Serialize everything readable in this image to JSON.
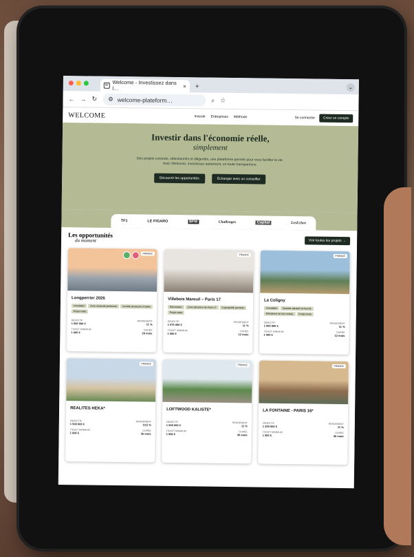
{
  "browser": {
    "tab_title": "Welcome - Investissez dans l…",
    "tab_close": "×",
    "new_tab": "+",
    "url": "welcome-plateform…",
    "favicon_text": "W"
  },
  "site": {
    "logo": "WELCOME",
    "nav": [
      "Investir",
      "Entreprises",
      "Méthode"
    ],
    "login": "Se connecter",
    "cta": "Créer un compte"
  },
  "hero": {
    "title": "Investir dans l'économie réelle,",
    "subtitle": "simplement",
    "description": "Des projets concrets, sélectionnés et diligentés, une plateforme pensée pour vous faciliter la vie. Avec Welcome, investissez autrement, en toute transparence.",
    "btn_primary": "Découvrir les opportunités",
    "btn_secondary": "Échanger avec un conseiller"
  },
  "press": [
    "TF1",
    "LE FIGARO",
    "BFM",
    "Challenges",
    "Capital",
    "LesEchos"
  ],
  "opportunities": {
    "title": "Les opportunités",
    "subtitle": "du moment",
    "see_all": "Voir toutes les projets →",
    "cards": [
      {
        "title": "Longperrier 2026",
        "badge": "FRANCE",
        "tags": [
          "Immobilier",
          "Zone d'activité pertinente",
          "Société structurée à faible",
          "Projet mixte"
        ],
        "s1_label": "OBJECTIF",
        "s1": "1 500 000 €",
        "s2_label": "RENDEMENT",
        "s2": "11 %",
        "s3_label": "TICKET MINIMUM",
        "s3": "1 000 €",
        "s4_label": "DURÉE",
        "s4": "24 mois",
        "img_colors": [
          "#f3c49a",
          "#9aa3ad",
          "#6f7b86"
        ]
      },
      {
        "title": "Villebois Mareuil – Paris 17",
        "badge": "FRANCE",
        "tags": [
          "Rénovation",
          "Zone attractive de Paris 17",
          "Copropriété premium",
          "Projet mixte"
        ],
        "s1_label": "OBJECTIF",
        "s1": "1 075 000 €",
        "s2_label": "RENDEMENT",
        "s2": "11 %",
        "s3_label": "TICKET MINIMUM",
        "s3": "1 000 €",
        "s4_label": "DURÉE",
        "s4": "12 mois",
        "img_colors": [
          "#e8e4df",
          "#bfb7ad",
          "#8a7f74"
        ]
      },
      {
        "title": "La Coligny",
        "badge": "FRANCE",
        "tags": [
          "Immobilier",
          "Quartier attractif recherché",
          "Résidence de bon niveau",
          "Projet mixte"
        ],
        "s1_label": "OBJECTIF",
        "s1": "1 000 000 €",
        "s2_label": "RENDEMENT",
        "s2": "11 %",
        "s3_label": "TICKET MINIMUM",
        "s3": "1 000 €",
        "s4_label": "DURÉE",
        "s4": "12 mois",
        "img_colors": [
          "#9cc0dc",
          "#5f7f57",
          "#b69a6f"
        ]
      },
      {
        "title": "REALITES HEKA*",
        "badge": "FRANCE",
        "tags": [],
        "s1_label": "OBJECTIF",
        "s1": "1 500 000 €",
        "s2_label": "RENDEMENT",
        "s2": "10,5 %",
        "s3_label": "TICKET MINIMUM",
        "s3": "1 000 €",
        "s4_label": "DURÉE",
        "s4": "36 mois",
        "img_colors": [
          "#c9d8e6",
          "#d6c4a3",
          "#6b8a55"
        ]
      },
      {
        "title": "LOFTWOOD KALISTE*",
        "badge": "FRANCE",
        "tags": [],
        "s1_label": "OBJECTIF",
        "s1": "1 500 000 €",
        "s2_label": "RENDEMENT",
        "s2": "11 %",
        "s3_label": "TICKET MINIMUM",
        "s3": "1 000 €",
        "s4_label": "DURÉE",
        "s4": "36 mois",
        "img_colors": [
          "#dfe8ef",
          "#5c8a4c",
          "#9a8f84"
        ]
      },
      {
        "title": "LA FONTAINE - PARIS 16*",
        "badge": "FRANCE",
        "tags": [],
        "s1_label": "OBJECTIF",
        "s1": "1 250 000 €",
        "s2_label": "RENDEMENT",
        "s2": "11 %",
        "s3_label": "TICKET MINIMUM",
        "s3": "1 000 €",
        "s4_label": "DURÉE",
        "s4": "36 mois",
        "img_colors": [
          "#d7b98f",
          "#8e6d4f",
          "#5f6d57"
        ]
      }
    ]
  },
  "colors": {
    "hero_bg": "#b3ba94",
    "dark_button": "#1e2b22",
    "tag_bg": "#d5d9c2"
  }
}
